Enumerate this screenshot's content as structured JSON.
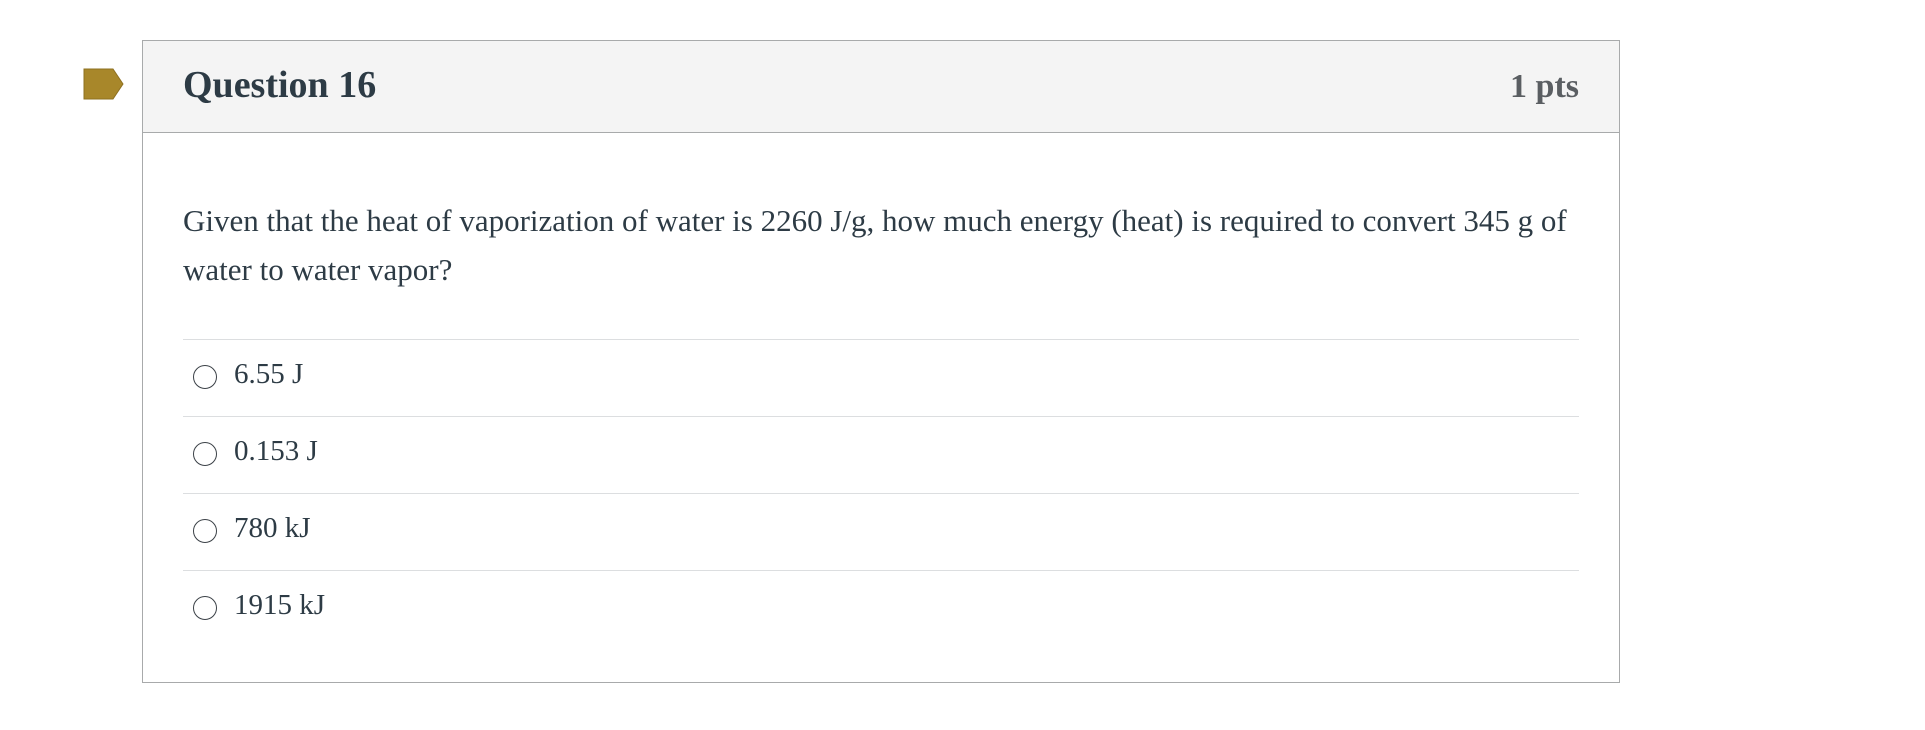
{
  "question": {
    "title": "Question 16",
    "points": "1 pts",
    "text": "Given that the heat of vaporization of water is 2260 J/g, how much energy (heat) is required to convert 345 g of water to water vapor?",
    "flag_icon": "bookmark-flag-icon",
    "flag_color": "#a8872a",
    "answers": [
      {
        "label": "6.55 J"
      },
      {
        "label": "0.153 J"
      },
      {
        "label": "780 kJ"
      },
      {
        "label": "1915 kJ"
      }
    ]
  }
}
